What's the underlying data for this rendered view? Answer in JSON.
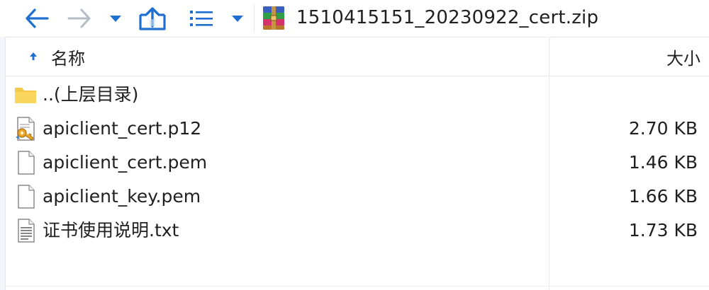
{
  "toolbar": {
    "back_icon": "arrow-left-icon",
    "forward_icon": "arrow-right-icon",
    "history_dropdown_icon": "chevron-down-icon",
    "up_icon": "folder-up-icon",
    "view_icon": "list-view-icon",
    "view_dropdown_icon": "chevron-down-icon"
  },
  "path": {
    "archive_icon": "winrar-archive-icon",
    "text": "1510415151_20230922_cert.zip"
  },
  "columns": {
    "name": "名称",
    "size": "大小",
    "sort_icon": "sort-up-icon"
  },
  "files": [
    {
      "name": "..(上层目录)",
      "size": "",
      "icon": "folder-icon"
    },
    {
      "name": "apiclient_cert.p12",
      "size": "2.70 KB",
      "icon": "certificate-file-icon"
    },
    {
      "name": "apiclient_cert.pem",
      "size": "1.46 KB",
      "icon": "blank-file-icon"
    },
    {
      "name": "apiclient_key.pem",
      "size": "1.66 KB",
      "icon": "blank-file-icon"
    },
    {
      "name": "证书使用说明.txt",
      "size": "1.73 KB",
      "icon": "text-file-icon"
    }
  ],
  "colors": {
    "accent_blue": "#1f6fd1",
    "disabled_gray": "#b4bcc7",
    "folder_yellow": "#f7c948"
  }
}
